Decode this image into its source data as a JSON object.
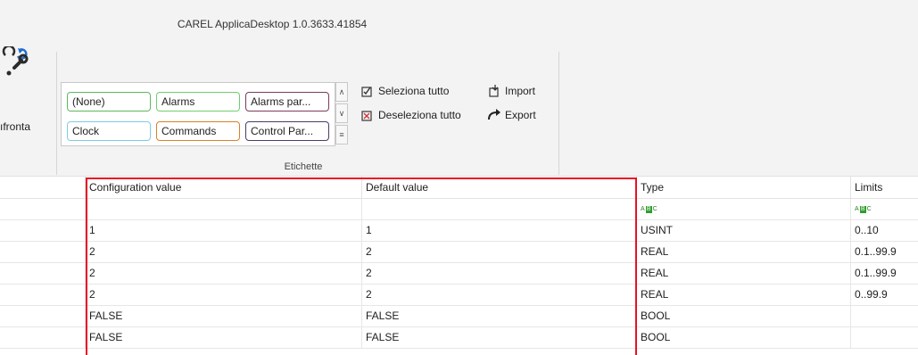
{
  "window": {
    "title": "CAREL ApplicaDesktop 1.0.3633.41854"
  },
  "ribbon": {
    "confronta_label": "ıfronta",
    "tags": [
      {
        "label": "(None)",
        "color": "#5cb85c"
      },
      {
        "label": "Alarms",
        "color": "#6fcf6f"
      },
      {
        "label": "Alarms par...",
        "color": "#7a3b5a"
      },
      {
        "label": "Clock",
        "color": "#7ecbe8"
      },
      {
        "label": "Commands",
        "color": "#d9822b"
      },
      {
        "label": "Control Par...",
        "color": "#4b3b6b"
      }
    ],
    "commands": {
      "select_all": "Seleziona tutto",
      "deselect_all": "Deseleziona tutto",
      "import": "Import",
      "export": "Export"
    },
    "group_label": "Etichette"
  },
  "grid": {
    "headers": {
      "configuration": "Configuration value",
      "default": "Default value",
      "type": "Type",
      "limits": "Limits"
    },
    "filter_icon_label": "ABC",
    "rows": [
      {
        "config": "1",
        "default": "1",
        "type": "USINT",
        "limits": "0..10"
      },
      {
        "config": "2",
        "default": "2",
        "type": "REAL",
        "limits": "0.1..99.9"
      },
      {
        "config": "2",
        "default": "2",
        "type": "REAL",
        "limits": "0.1..99.9"
      },
      {
        "config": "2",
        "default": "2",
        "type": "REAL",
        "limits": "0..99.9"
      },
      {
        "config": "FALSE",
        "default": "FALSE",
        "type": "BOOL",
        "limits": ""
      },
      {
        "config": "FALSE",
        "default": "FALSE",
        "type": "BOOL",
        "limits": ""
      }
    ]
  },
  "colors": {
    "highlight": "#e81123",
    "ribbon_bg": "#f3f3f3"
  }
}
